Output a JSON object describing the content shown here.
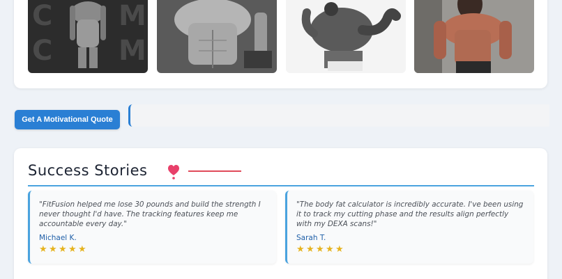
{
  "gallery": {
    "images": [
      {
        "icon": "bodybuilder-photo-icon"
      },
      {
        "icon": "bodybuilder-photo-icon"
      },
      {
        "icon": "bodybuilder-sketch-icon"
      },
      {
        "icon": "bodybuilder-photo-icon"
      }
    ]
  },
  "quote": {
    "button_label": "Get A Motivational Quote",
    "text": ""
  },
  "stories": {
    "title": "Success Stories",
    "title_icon": "heart-icon",
    "testimonials": [
      {
        "text": "\"FitFusion helped me lose 30 pounds and build the strength I never thought I'd have. The tracking features keep me accountable every day.\"",
        "author": "Michael K.",
        "rating": 5
      },
      {
        "text": "\"The body fat calculator is incredibly accurate. I've been using it to track my cutting phase and the results align perfectly with my DEXA scans!\"",
        "author": "Sarah T.",
        "rating": 5
      }
    ]
  },
  "colors": {
    "accent_blue": "#2a7fd4",
    "rule_blue": "#4aa3df",
    "heart_pink": "#e04a5a",
    "star_gold": "#e6b31e",
    "author_blue": "#1f5fa8"
  }
}
